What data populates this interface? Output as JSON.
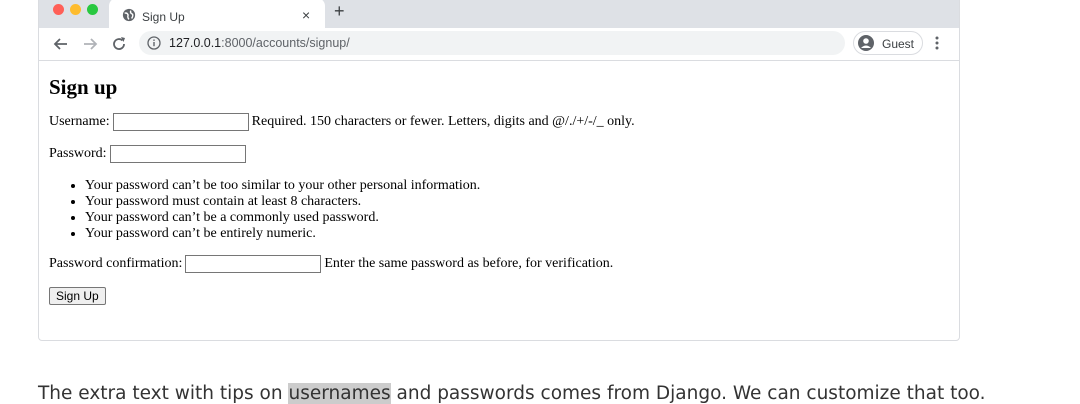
{
  "browser": {
    "tab_title": "Sign Up",
    "tab_close": "×",
    "new_tab": "+",
    "url_host": "127.0.0.1",
    "url_rest": ":8000/accounts/signup/",
    "profile_label": "Guest",
    "traffic_lights": [
      "#ff5f57",
      "#febc2e",
      "#28c840"
    ]
  },
  "page": {
    "heading": "Sign up",
    "username_label": "Username:",
    "username_value": "",
    "username_help": "Required. 150 characters or fewer. Letters, digits and @/./+/-/_ only.",
    "password_label": "Password:",
    "password_value": "",
    "password_rules": [
      "Your password can’t be too similar to your other personal information.",
      "Your password must contain at least 8 characters.",
      "Your password can’t be a commonly used password.",
      "Your password can’t be entirely numeric."
    ],
    "confirm_label": "Password confirmation:",
    "confirm_value": "",
    "confirm_help": "Enter the same password as before, for verification.",
    "submit_label": "Sign Up"
  },
  "caption": {
    "before": "The extra text with tips on ",
    "highlight": "usernames",
    "after": " and passwords comes from Django. We can customize that too."
  }
}
